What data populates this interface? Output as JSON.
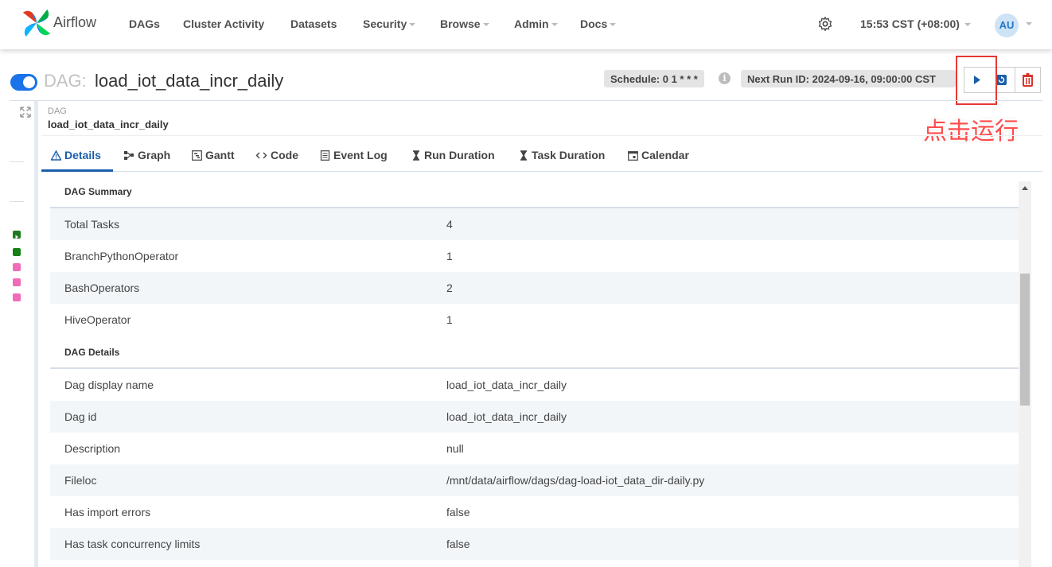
{
  "app": {
    "brand": "Airflow"
  },
  "nav": {
    "items": [
      {
        "label": "DAGs",
        "dropdown": false
      },
      {
        "label": "Cluster Activity",
        "dropdown": false
      },
      {
        "label": "Datasets",
        "dropdown": false
      },
      {
        "label": "Security",
        "dropdown": true
      },
      {
        "label": "Browse",
        "dropdown": true
      },
      {
        "label": "Admin",
        "dropdown": true
      },
      {
        "label": "Docs",
        "dropdown": true
      }
    ],
    "time": "15:53 CST (+08:00)",
    "avatar": "AU",
    "settings_icon": "gear-icon"
  },
  "dag_header": {
    "prefix": "DAG:",
    "title": "load_iot_data_incr_daily",
    "active": true,
    "schedule": "Schedule: 0 1 * * *",
    "info_glyph": "i",
    "next_run": "Next Run ID: 2024-09-16, 09:00:00 CST",
    "buttons": [
      "trigger-dag",
      "refresh",
      "delete"
    ]
  },
  "annotation": {
    "text": "点击运行",
    "color": "#ff4d4d",
    "box_color": "#e53935"
  },
  "breadcrumb": {
    "label": "DAG",
    "name": "load_iot_data_incr_daily"
  },
  "grid_legend": {
    "squares": [
      {
        "state": "running",
        "color": "#1e7b1e",
        "icon": "play-icon"
      },
      {
        "state": "success",
        "color": "#168016"
      },
      {
        "state": "pink",
        "color": "#f06bb8"
      },
      {
        "state": "pink",
        "color": "#f06bb8"
      },
      {
        "state": "pink",
        "color": "#f06bb8"
      }
    ]
  },
  "tabs": [
    {
      "label": "Details",
      "icon": "warning-icon",
      "active": true
    },
    {
      "label": "Graph",
      "icon": "graph-icon",
      "active": false
    },
    {
      "label": "Gantt",
      "icon": "gantt-icon",
      "active": false
    },
    {
      "label": "Code",
      "icon": "code-icon",
      "active": false
    },
    {
      "label": "Event Log",
      "icon": "document-icon",
      "active": false
    },
    {
      "label": "Run Duration",
      "icon": "hourglass-icon",
      "active": false
    },
    {
      "label": "Task Duration",
      "icon": "hourglass-icon",
      "active": false
    },
    {
      "label": "Calendar",
      "icon": "calendar-icon",
      "active": false
    }
  ],
  "details": {
    "summary_title": "DAG Summary",
    "summary": [
      {
        "key": "Total Tasks",
        "value": "4"
      },
      {
        "key": "BranchPythonOperator",
        "value": "1"
      },
      {
        "key": "BashOperators",
        "value": "2"
      },
      {
        "key": "HiveOperator",
        "value": "1"
      }
    ],
    "details_title": "DAG Details",
    "details": [
      {
        "key": "Dag display name",
        "value": "load_iot_data_incr_daily"
      },
      {
        "key": "Dag id",
        "value": "load_iot_data_incr_daily"
      },
      {
        "key": "Description",
        "value": "null"
      },
      {
        "key": "Fileloc",
        "value": "/mnt/data/airflow/dags/dag-load-iot_data_dir-daily.py"
      },
      {
        "key": "Has import errors",
        "value": "false"
      },
      {
        "key": "Has task concurrency limits",
        "value": "false"
      }
    ]
  }
}
